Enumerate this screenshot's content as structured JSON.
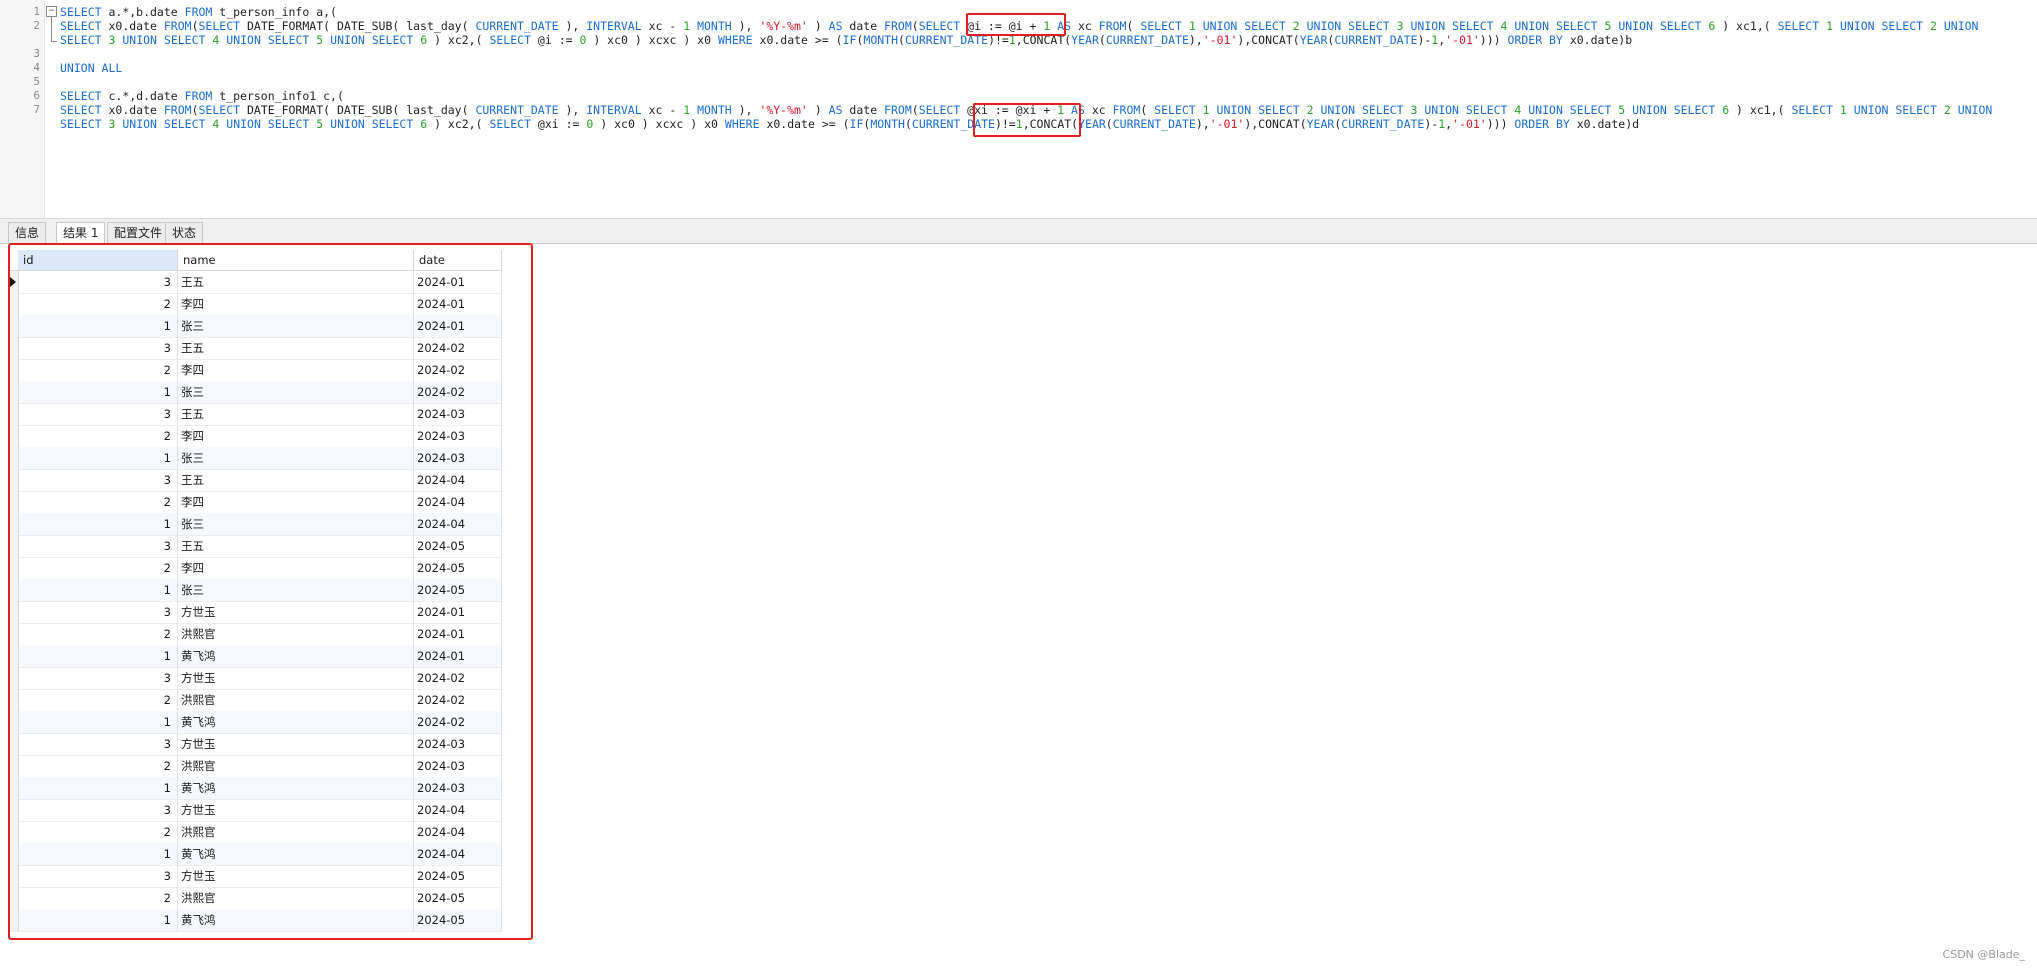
{
  "editor": {
    "line_numbers": [
      "1",
      "2",
      "",
      "3",
      "4",
      "5",
      "6",
      "7",
      ""
    ],
    "fold_glyph": "−",
    "lines": [
      [
        [
          "kw",
          "SELECT"
        ],
        [
          "plain",
          " a.*,b.date "
        ],
        [
          "kw",
          "FROM"
        ],
        [
          "plain",
          " t_person_info a,("
        ]
      ],
      [
        [
          "kw",
          "SELECT"
        ],
        [
          "plain",
          " x0.date "
        ],
        [
          "kw",
          "FROM"
        ],
        [
          "plain",
          "("
        ],
        [
          "kw",
          "SELECT"
        ],
        [
          "plain",
          " DATE_FORMAT( DATE_SUB( last_day( "
        ],
        [
          "kw",
          "CURRENT_DATE"
        ],
        [
          "plain",
          " ), "
        ],
        [
          "kw",
          "INTERVAL"
        ],
        [
          "plain",
          " xc - "
        ],
        [
          "num",
          "1"
        ],
        [
          "plain",
          " "
        ],
        [
          "kw",
          "MONTH"
        ],
        [
          "plain",
          " ), "
        ],
        [
          "str",
          "'%Y-%m'"
        ],
        [
          "plain",
          " ) "
        ],
        [
          "kw",
          "AS"
        ],
        [
          "plain",
          " date "
        ],
        [
          "kw",
          "FROM"
        ],
        [
          "plain",
          "("
        ],
        [
          "kw",
          "SELECT"
        ],
        [
          "plain",
          " @i := @i + "
        ],
        [
          "num",
          "1"
        ],
        [
          "plain",
          " "
        ],
        [
          "kw",
          "AS"
        ],
        [
          "plain",
          " xc "
        ],
        [
          "kw",
          "FROM"
        ],
        [
          "plain",
          "( "
        ],
        [
          "kw",
          "SELECT"
        ],
        [
          "plain",
          " "
        ],
        [
          "num",
          "1"
        ],
        [
          "plain",
          " "
        ],
        [
          "kw",
          "UNION SELECT"
        ],
        [
          "plain",
          " "
        ],
        [
          "num",
          "2"
        ],
        [
          "plain",
          " "
        ],
        [
          "kw",
          "UNION SELECT"
        ],
        [
          "plain",
          " "
        ],
        [
          "num",
          "3"
        ],
        [
          "plain",
          " "
        ],
        [
          "kw",
          "UNION SELECT"
        ],
        [
          "plain",
          " "
        ],
        [
          "num",
          "4"
        ],
        [
          "plain",
          " "
        ],
        [
          "kw",
          "UNION SELECT"
        ],
        [
          "plain",
          " "
        ],
        [
          "num",
          "5"
        ],
        [
          "plain",
          " "
        ],
        [
          "kw",
          "UNION SELECT"
        ],
        [
          "plain",
          " "
        ],
        [
          "num",
          "6"
        ],
        [
          "plain",
          " ) xc1,( "
        ],
        [
          "kw",
          "SELECT"
        ],
        [
          "plain",
          " "
        ],
        [
          "num",
          "1"
        ],
        [
          "plain",
          " "
        ],
        [
          "kw",
          "UNION SELECT"
        ],
        [
          "plain",
          " "
        ],
        [
          "num",
          "2"
        ],
        [
          "plain",
          " "
        ],
        [
          "kw",
          "UNION"
        ]
      ],
      [
        [
          "kw",
          "SELECT"
        ],
        [
          "plain",
          " "
        ],
        [
          "num",
          "3"
        ],
        [
          "plain",
          " "
        ],
        [
          "kw",
          "UNION SELECT"
        ],
        [
          "plain",
          " "
        ],
        [
          "num",
          "4"
        ],
        [
          "plain",
          " "
        ],
        [
          "kw",
          "UNION SELECT"
        ],
        [
          "plain",
          " "
        ],
        [
          "num",
          "5"
        ],
        [
          "plain",
          " "
        ],
        [
          "kw",
          "UNION SELECT"
        ],
        [
          "plain",
          " "
        ],
        [
          "num",
          "6"
        ],
        [
          "plain",
          " ) xc2,( "
        ],
        [
          "kw",
          "SELECT"
        ],
        [
          "plain",
          " @i := "
        ],
        [
          "num",
          "0"
        ],
        [
          "plain",
          " ) xc0 ) xcxc ) x0 "
        ],
        [
          "kw",
          "WHERE"
        ],
        [
          "plain",
          " x0.date >= ("
        ],
        [
          "kw",
          "IF"
        ],
        [
          "plain",
          "("
        ],
        [
          "kw",
          "MONTH"
        ],
        [
          "plain",
          "("
        ],
        [
          "kw",
          "CURRENT_DATE"
        ],
        [
          "plain",
          ")!="
        ],
        [
          "num",
          "1"
        ],
        [
          "plain",
          ",CONCAT("
        ],
        [
          "kw",
          "YEAR"
        ],
        [
          "plain",
          "("
        ],
        [
          "kw",
          "CURRENT_DATE"
        ],
        [
          "plain",
          "),"
        ],
        [
          "str",
          "'-01'"
        ],
        [
          "plain",
          "),CONCAT("
        ],
        [
          "kw",
          "YEAR"
        ],
        [
          "plain",
          "("
        ],
        [
          "kw",
          "CURRENT_DATE"
        ],
        [
          "plain",
          ")-"
        ],
        [
          "num",
          "1"
        ],
        [
          "plain",
          ","
        ],
        [
          "str",
          "'-01'"
        ],
        [
          "plain",
          "))) "
        ],
        [
          "kw",
          "ORDER BY"
        ],
        [
          "plain",
          " x0.date)b"
        ]
      ],
      [],
      [
        [
          "kw",
          "UNION ALL"
        ]
      ],
      [],
      [
        [
          "kw",
          "SELECT"
        ],
        [
          "plain",
          " c.*,d.date "
        ],
        [
          "kw",
          "FROM"
        ],
        [
          "plain",
          " t_person_info1 c,("
        ]
      ],
      [
        [
          "kw",
          "SELECT"
        ],
        [
          "plain",
          " x0.date "
        ],
        [
          "kw",
          "FROM"
        ],
        [
          "plain",
          "("
        ],
        [
          "kw",
          "SELECT"
        ],
        [
          "plain",
          " DATE_FORMAT( DATE_SUB( last_day( "
        ],
        [
          "kw",
          "CURRENT_DATE"
        ],
        [
          "plain",
          " ), "
        ],
        [
          "kw",
          "INTERVAL"
        ],
        [
          "plain",
          " xc - "
        ],
        [
          "num",
          "1"
        ],
        [
          "plain",
          " "
        ],
        [
          "kw",
          "MONTH"
        ],
        [
          "plain",
          " ), "
        ],
        [
          "str",
          "'%Y-%m'"
        ],
        [
          "plain",
          " ) "
        ],
        [
          "kw",
          "AS"
        ],
        [
          "plain",
          " date "
        ],
        [
          "kw",
          "FROM"
        ],
        [
          "plain",
          "("
        ],
        [
          "kw",
          "SELECT"
        ],
        [
          "plain",
          " @xi := @xi + "
        ],
        [
          "num",
          "1"
        ],
        [
          "plain",
          " "
        ],
        [
          "kw",
          "AS"
        ],
        [
          "plain",
          " xc "
        ],
        [
          "kw",
          "FROM"
        ],
        [
          "plain",
          "( "
        ],
        [
          "kw",
          "SELECT"
        ],
        [
          "plain",
          " "
        ],
        [
          "num",
          "1"
        ],
        [
          "plain",
          " "
        ],
        [
          "kw",
          "UNION SELECT"
        ],
        [
          "plain",
          " "
        ],
        [
          "num",
          "2"
        ],
        [
          "plain",
          " "
        ],
        [
          "kw",
          "UNION SELECT"
        ],
        [
          "plain",
          " "
        ],
        [
          "num",
          "3"
        ],
        [
          "plain",
          " "
        ],
        [
          "kw",
          "UNION SELECT"
        ],
        [
          "plain",
          " "
        ],
        [
          "num",
          "4"
        ],
        [
          "plain",
          " "
        ],
        [
          "kw",
          "UNION SELECT"
        ],
        [
          "plain",
          " "
        ],
        [
          "num",
          "5"
        ],
        [
          "plain",
          " "
        ],
        [
          "kw",
          "UNION SELECT"
        ],
        [
          "plain",
          " "
        ],
        [
          "num",
          "6"
        ],
        [
          "plain",
          " ) xc1,( "
        ],
        [
          "kw",
          "SELECT"
        ],
        [
          "plain",
          " "
        ],
        [
          "num",
          "1"
        ],
        [
          "plain",
          " "
        ],
        [
          "kw",
          "UNION SELECT"
        ],
        [
          "plain",
          " "
        ],
        [
          "num",
          "2"
        ],
        [
          "plain",
          " "
        ],
        [
          "kw",
          "UNION"
        ]
      ],
      [
        [
          "kw",
          "SELECT"
        ],
        [
          "plain",
          " "
        ],
        [
          "num",
          "3"
        ],
        [
          "plain",
          " "
        ],
        [
          "kw",
          "UNION SELECT"
        ],
        [
          "plain",
          " "
        ],
        [
          "num",
          "4"
        ],
        [
          "plain",
          " "
        ],
        [
          "kw",
          "UNION SELECT"
        ],
        [
          "plain",
          " "
        ],
        [
          "num",
          "5"
        ],
        [
          "plain",
          " "
        ],
        [
          "kw",
          "UNION SELECT"
        ],
        [
          "plain",
          " "
        ],
        [
          "num",
          "6"
        ],
        [
          "plain",
          " ) xc2,( "
        ],
        [
          "kw",
          "SELECT"
        ],
        [
          "plain",
          " @xi := "
        ],
        [
          "num",
          "0"
        ],
        [
          "plain",
          " ) xc0 ) xcxc ) x0 "
        ],
        [
          "kw",
          "WHERE"
        ],
        [
          "plain",
          " x0.date >= ("
        ],
        [
          "kw",
          "IF"
        ],
        [
          "plain",
          "("
        ],
        [
          "kw",
          "MONTH"
        ],
        [
          "plain",
          "("
        ],
        [
          "kw",
          "CURRENT_DATE"
        ],
        [
          "plain",
          ")!="
        ],
        [
          "num",
          "1"
        ],
        [
          "plain",
          ",CONCAT("
        ],
        [
          "kw",
          "YEAR"
        ],
        [
          "plain",
          "("
        ],
        [
          "kw",
          "CURRENT_DATE"
        ],
        [
          "plain",
          "),"
        ],
        [
          "str",
          "'-01'"
        ],
        [
          "plain",
          "),CONCAT("
        ],
        [
          "kw",
          "YEAR"
        ],
        [
          "plain",
          "("
        ],
        [
          "kw",
          "CURRENT_DATE"
        ],
        [
          "plain",
          ")-"
        ],
        [
          "num",
          "1"
        ],
        [
          "plain",
          ","
        ],
        [
          "str",
          "'-01'"
        ],
        [
          "plain",
          "))) "
        ],
        [
          "kw",
          "ORDER BY"
        ],
        [
          "plain",
          " x0.date)d"
        ]
      ]
    ]
  },
  "tabs": [
    {
      "label": "信息",
      "active": false
    },
    {
      "label": "结果 1",
      "active": true
    },
    {
      "label": "配置文件",
      "active": false
    },
    {
      "label": "状态",
      "active": false
    }
  ],
  "grid": {
    "columns": [
      "id",
      "name",
      "date"
    ],
    "rows": [
      [
        "3",
        "王五",
        "2024-01"
      ],
      [
        "2",
        "李四",
        "2024-01"
      ],
      [
        "1",
        "张三",
        "2024-01"
      ],
      [
        "3",
        "王五",
        "2024-02"
      ],
      [
        "2",
        "李四",
        "2024-02"
      ],
      [
        "1",
        "张三",
        "2024-02"
      ],
      [
        "3",
        "王五",
        "2024-03"
      ],
      [
        "2",
        "李四",
        "2024-03"
      ],
      [
        "1",
        "张三",
        "2024-03"
      ],
      [
        "3",
        "王五",
        "2024-04"
      ],
      [
        "2",
        "李四",
        "2024-04"
      ],
      [
        "1",
        "张三",
        "2024-04"
      ],
      [
        "3",
        "王五",
        "2024-05"
      ],
      [
        "2",
        "李四",
        "2024-05"
      ],
      [
        "1",
        "张三",
        "2024-05"
      ],
      [
        "3",
        "方世玉",
        "2024-01"
      ],
      [
        "2",
        "洪熙官",
        "2024-01"
      ],
      [
        "1",
        "黄飞鸿",
        "2024-01"
      ],
      [
        "3",
        "方世玉",
        "2024-02"
      ],
      [
        "2",
        "洪熙官",
        "2024-02"
      ],
      [
        "1",
        "黄飞鸿",
        "2024-02"
      ],
      [
        "3",
        "方世玉",
        "2024-03"
      ],
      [
        "2",
        "洪熙官",
        "2024-03"
      ],
      [
        "1",
        "黄飞鸿",
        "2024-03"
      ],
      [
        "3",
        "方世玉",
        "2024-04"
      ],
      [
        "2",
        "洪熙官",
        "2024-04"
      ],
      [
        "1",
        "黄飞鸿",
        "2024-04"
      ],
      [
        "3",
        "方世玉",
        "2024-05"
      ],
      [
        "2",
        "洪熙官",
        "2024-05"
      ],
      [
        "1",
        "黄飞鸿",
        "2024-05"
      ]
    ]
  },
  "watermark": "CSDN @Blade_"
}
